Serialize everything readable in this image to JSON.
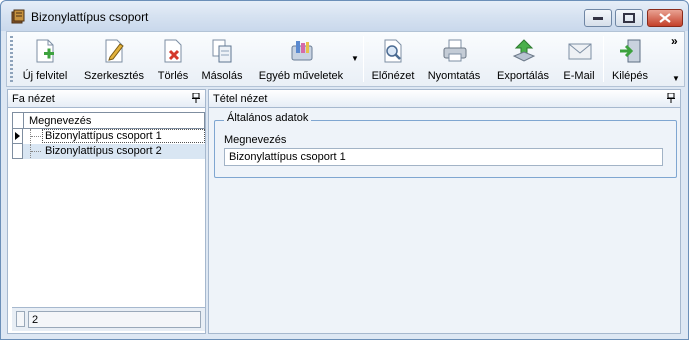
{
  "window": {
    "title": "Bizonylattípus csoport",
    "icon": "app-icon"
  },
  "toolbar": {
    "buttons": [
      {
        "label": "Új felvitel",
        "icon": "new-record-icon"
      },
      {
        "label": "Szerkesztés",
        "icon": "edit-icon"
      },
      {
        "label": "Törlés",
        "icon": "delete-icon"
      },
      {
        "label": "Másolás",
        "icon": "copy-icon"
      },
      {
        "label": "Egyéb műveletek",
        "icon": "other-actions-icon"
      },
      {
        "label": "Előnézet",
        "icon": "preview-icon"
      },
      {
        "label": "Nyomtatás",
        "icon": "print-icon"
      },
      {
        "label": "Exportálás",
        "icon": "export-icon"
      },
      {
        "label": "E-Mail",
        "icon": "email-icon"
      },
      {
        "label": "Kilépés",
        "icon": "exit-icon"
      }
    ],
    "overflow": "»"
  },
  "tree_pane": {
    "title": "Fa nézet",
    "column_header": "Megnevezés",
    "rows": [
      {
        "label": "Bizonylattípus csoport 1",
        "selected": true
      },
      {
        "label": "Bizonylattípus csoport 2",
        "selected": false
      }
    ],
    "count": "2"
  },
  "detail_pane": {
    "title": "Tétel nézet",
    "group_title": "Általános adatok",
    "field_label": "Megnevezés",
    "field_value": "Bizonylattípus csoport 1"
  },
  "colors": {
    "accent": "#7fa6d1",
    "window_bg": "#dde7f3",
    "selection_row": "#d9e6f3"
  }
}
